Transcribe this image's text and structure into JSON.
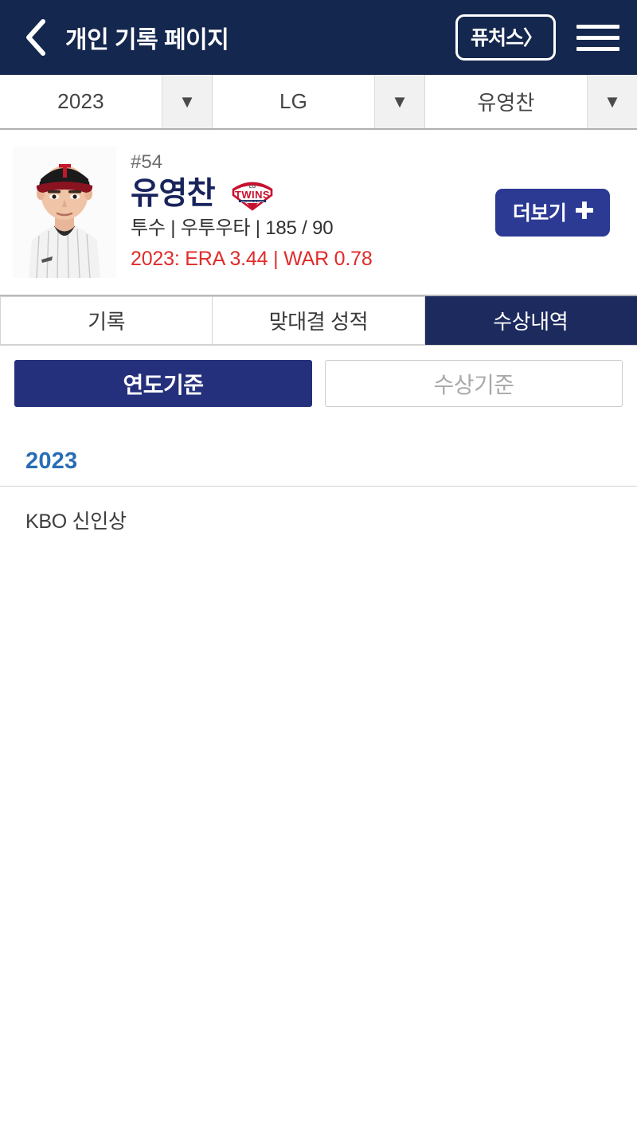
{
  "header": {
    "back_icon": "chevron-left-icon",
    "title": "개인 기록 페이지",
    "futures_label": "퓨처스〉",
    "menu_icon": "hamburger-menu-icon",
    "bg_color": "#14274e"
  },
  "filters": [
    {
      "name": "season",
      "value": "2023",
      "arrow": "▼"
    },
    {
      "name": "team",
      "value": "LG",
      "arrow": "▼"
    },
    {
      "name": "player",
      "value": "유영찬",
      "arrow": "▼"
    }
  ],
  "player": {
    "photo_alt": "player-headshot",
    "number": "#54",
    "name": "유영찬",
    "team_logo_top": "LG",
    "team_logo_main": "TWINS",
    "team_logo_sub": "1990 SEOUL LG TWINS",
    "meta": "투수 | 우투우타 | 185 / 90",
    "stats": "2023: ERA 3.44 | WAR 0.78",
    "stats_color": "#e02b2b",
    "more_label": "더보기",
    "more_plus": "✚"
  },
  "tabs": [
    {
      "label": "기록",
      "active": false
    },
    {
      "label": "맞대결 성적",
      "active": false
    },
    {
      "label": "수상내역",
      "active": true
    }
  ],
  "subtabs": [
    {
      "label": "연도기준",
      "active": true
    },
    {
      "label": "수상기준",
      "active": false
    }
  ],
  "awards": [
    {
      "year": "2023",
      "items": [
        "KBO 신인상"
      ]
    }
  ],
  "colors": {
    "header_navy": "#14274e",
    "active_tab_navy": "#1d2a5e",
    "subtab_blue": "#25307c",
    "more_button_blue": "#2c3a94",
    "year_blue": "#2a6db5",
    "name_navy": "#18245c",
    "stat_red": "#e02b2b"
  }
}
